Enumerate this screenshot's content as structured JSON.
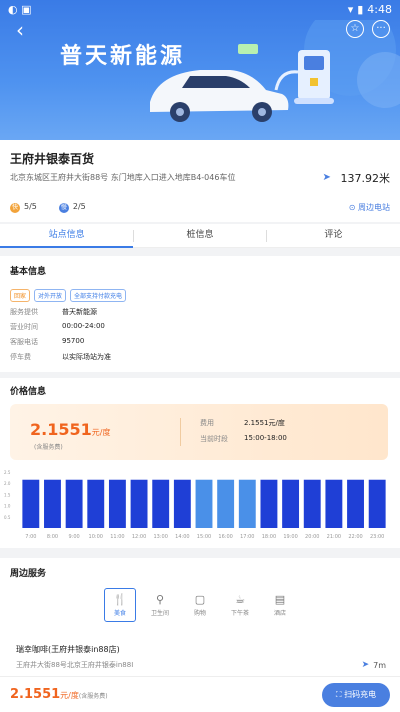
{
  "status_bar": {
    "time": "4:48"
  },
  "hero": {
    "title": "普天新能源"
  },
  "station": {
    "name": "王府井银泰百货",
    "address": "北京东城区王府井大街88号 东门地库入口进入地库B4-046车位",
    "distance": "137.92米",
    "fast": "5/5",
    "slow": "2/5",
    "nearby_link": "周边电站"
  },
  "tabs": [
    "站点信息",
    "桩信息",
    "评论"
  ],
  "basic": {
    "title": "基本信息",
    "tags": [
      "回家",
      "对外开放",
      "全部支持付款充电"
    ],
    "rows": [
      {
        "k": "服务提供",
        "v": "普天新能源"
      },
      {
        "k": "营业时间",
        "v": "00:00-24:00"
      },
      {
        "k": "客服电话",
        "v": "95700"
      },
      {
        "k": "停车费",
        "v": "以实际场站为准"
      }
    ]
  },
  "price": {
    "title": "价格信息",
    "value": "2.1551",
    "unit": "元/度",
    "note": "(含服务费)",
    "fee_label": "费用",
    "fee_value": "2.1551元/度",
    "period_label": "当前时段",
    "period_value": "15:00-18:00"
  },
  "chart_data": {
    "type": "bar",
    "categories": [
      "7:00",
      "8:00",
      "9:00",
      "10:00",
      "11:00",
      "12:00",
      "13:00",
      "14:00",
      "15:00",
      "16:00",
      "17:00",
      "18:00",
      "19:00",
      "20:00",
      "21:00",
      "22:00",
      "23:00"
    ],
    "values": [
      2.1551,
      2.1551,
      2.1551,
      2.1551,
      2.1551,
      2.1551,
      2.1551,
      2.1551,
      2.1551,
      2.1551,
      2.1551,
      2.1551,
      2.1551,
      2.1551,
      2.1551,
      2.1551,
      2.1551
    ],
    "highlight": [
      8,
      9,
      10
    ],
    "ylabel": "",
    "ylim": [
      0,
      2.5
    ],
    "yticks": [
      "2.5",
      "2.0",
      "1.5",
      "1.0",
      "0.5"
    ],
    "colors": {
      "normal": "#1f3fd6",
      "highlight": "#4a90e8"
    }
  },
  "nearby": {
    "title": "周边服务",
    "services": [
      {
        "label": "美食",
        "icon": "food-icon"
      },
      {
        "label": "卫生间",
        "icon": "toilet-icon"
      },
      {
        "label": "购物",
        "icon": "shopping-icon"
      },
      {
        "label": "下午茶",
        "icon": "tea-icon"
      },
      {
        "label": "酒店",
        "icon": "hotel-icon"
      }
    ],
    "poi_name": "瑞幸咖啡(王府井银泰in88店)",
    "poi_addr": "王府井大街88号北京王府井银泰in88I",
    "poi_dist": "7m"
  },
  "bottom": {
    "price": "2.1551",
    "unit": "元/度",
    "note": "(含服务费)",
    "scan_label": "扫码充电"
  }
}
